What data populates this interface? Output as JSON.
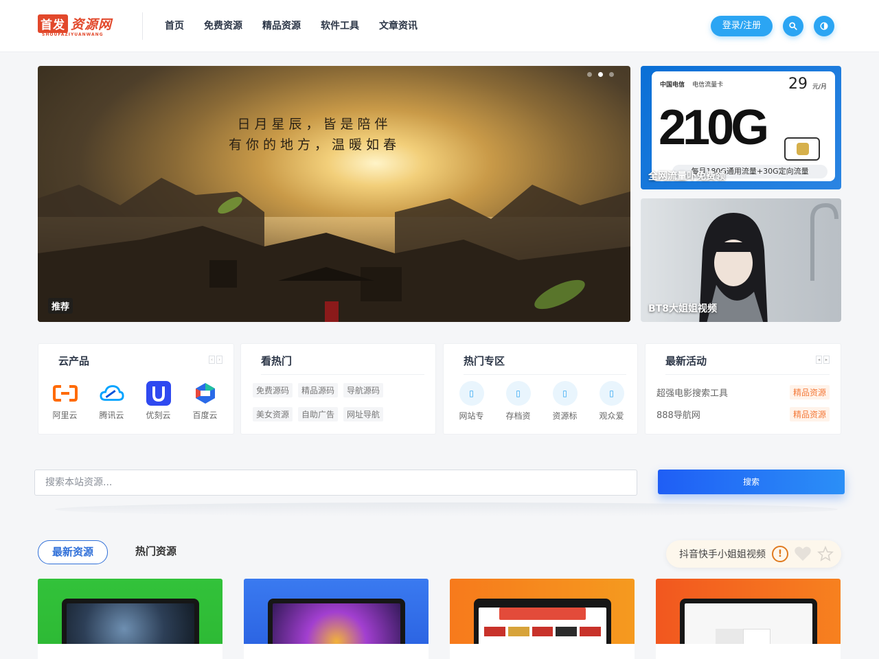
{
  "logo": {
    "main": "首发",
    "script": "资源网",
    "sub": "SHOUFAZIYUANWANG"
  },
  "nav": [
    "首页",
    "免费资源",
    "精品资源",
    "软件工具",
    "文章资讯"
  ],
  "header": {
    "login_label": "登录/注册",
    "search_icon": "search-icon",
    "theme_icon": "theme-toggle-icon",
    "accent": "#2ba5f3"
  },
  "banner": {
    "poem_line1": "日月星辰，皆是陪伴",
    "poem_line2": "有你的地方，温暖如春",
    "tag": "推荐",
    "dots": 3,
    "active_dot": 2
  },
  "side_cards": [
    {
      "caption": "全网流量卟免费领",
      "telecom_brand": "中国电信",
      "telecom_card": "电信流量卡",
      "price": "29",
      "price_unit": "元/月",
      "big_text": "210G",
      "bar_text": "每月180G通用流量+30G定向流量"
    },
    {
      "caption": "BT8大姐姐视频"
    }
  ],
  "widgets": {
    "cloud": {
      "title": "云产品",
      "items": [
        {
          "label": "阿里云",
          "icon": "aliyun-icon"
        },
        {
          "label": "腾讯云",
          "icon": "tencent-cloud-icon"
        },
        {
          "label": "优刻云",
          "icon": "ucloud-icon"
        },
        {
          "label": "百度云",
          "icon": "baidu-cloud-icon"
        }
      ]
    },
    "hot_view": {
      "title": "看热门",
      "tags": [
        "免费源码",
        "精品源码",
        "导航源码",
        "美女资源",
        "自助广告",
        "网址导航"
      ]
    },
    "hot_zone": {
      "title": "热门专区",
      "items": [
        {
          "label": "网站专",
          "glyph": "▯"
        },
        {
          "label": "存档资",
          "glyph": "▯"
        },
        {
          "label": "资源标",
          "glyph": "▯"
        },
        {
          "label": "观众爱",
          "glyph": "▯"
        }
      ]
    },
    "activity": {
      "title": "最新活动",
      "items": [
        {
          "text": "超强电影搜索工具",
          "badge": "精品资源"
        },
        {
          "text": "888导航网",
          "badge": "精品资源"
        }
      ]
    }
  },
  "search": {
    "placeholder": "搜索本站资源...",
    "button": "搜索"
  },
  "tabs": [
    {
      "label": "最新资源",
      "active": true
    },
    {
      "label": "热门资源",
      "active": false
    }
  ],
  "promo": {
    "text": "抖音快手小姐姐视频",
    "warn": "!"
  }
}
